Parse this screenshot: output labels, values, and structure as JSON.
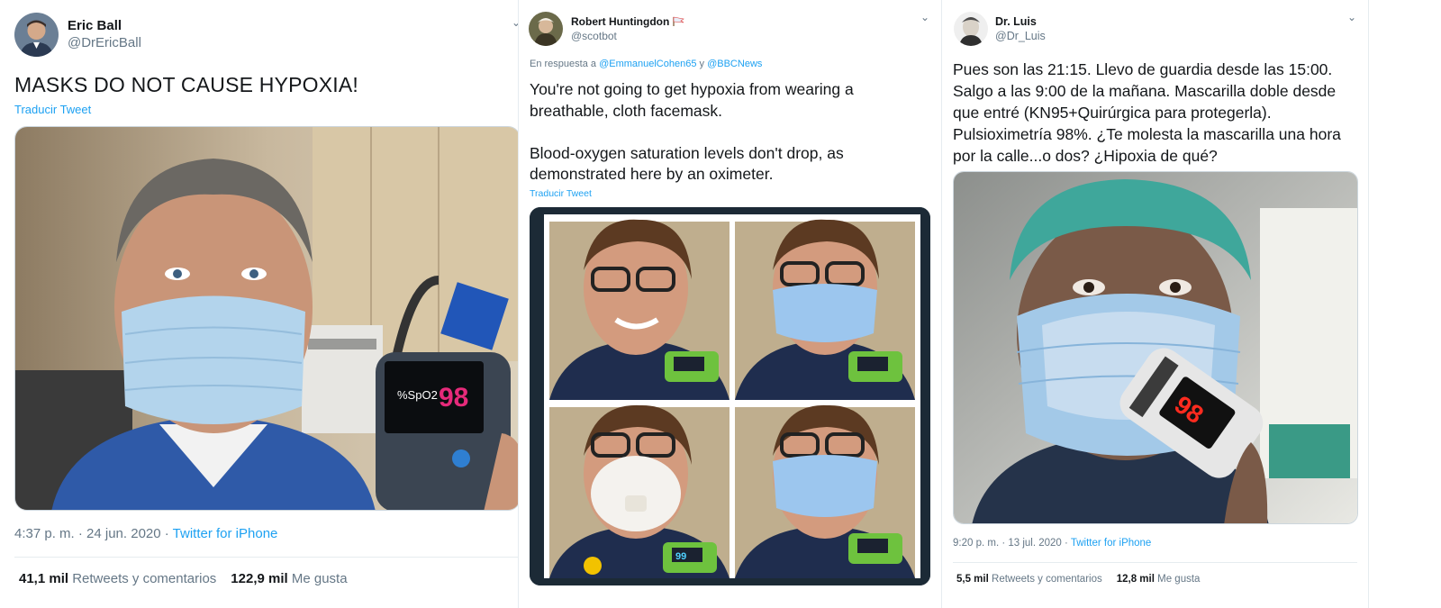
{
  "tweets": [
    {
      "name": "Eric Ball",
      "handle": "@DrEricBall",
      "text": "MASKS DO NOT CAUSE HYPOXIA!",
      "translate": "Traducir Tweet",
      "time": "4:37 p. m. · 24 jun. 2020 · ",
      "source": "Twitter for iPhone",
      "retweets_count": "41,1 mil",
      "retweets_label": "Retweets y comentarios",
      "likes_count": "122,9 mil",
      "likes_label": "Me gusta",
      "oximeter_reading": "98"
    },
    {
      "name": "Robert Huntingdon",
      "handle": "@scotbot",
      "reply_prefix": "En respuesta a ",
      "reply_user1": "@EmmanuelCohen65",
      "reply_and": " y ",
      "reply_user2": "@BBCNews",
      "text": "You're not going to get hypoxia from wearing a\nbreathable, cloth facemask.\n\nBlood-oxygen saturation levels don't drop, as\ndemonstrated here by an oximeter.",
      "translate": "Traducir Tweet",
      "oximeter_reading": "99"
    },
    {
      "name": "Dr. Luis",
      "handle": "@Dr_Luis",
      "text": "Pues son las 21:15. Llevo de guardia desde las 15:00.\nSalgo a las 9:00 de la mañana. Mascarilla doble desde\nque entré (KN95+Quirúrgica para protegerla).\nPulsioximetría 98%. ¿Te molesta la mascarilla una hora\npor la calle...o dos? ¿Hipoxia de qué?",
      "time": "9:20 p. m. · 13 jul. 2020 · ",
      "source": "Twitter for iPhone",
      "retweets_count": "5,5 mil",
      "retweets_label": "Retweets y comentarios",
      "likes_count": "12,8 mil",
      "likes_label": "Me gusta",
      "oximeter_reading": "98"
    }
  ],
  "icons": {
    "chevron": "chevron-down-icon",
    "flag": "flag-emoji-icon"
  },
  "colors": {
    "link": "#1da1f2",
    "muted": "#657786",
    "text": "#14171a",
    "mask_blue": "#a9cde8",
    "scrub_blue": "#2f5aa8",
    "surgical_cap": "#3fa79b"
  }
}
